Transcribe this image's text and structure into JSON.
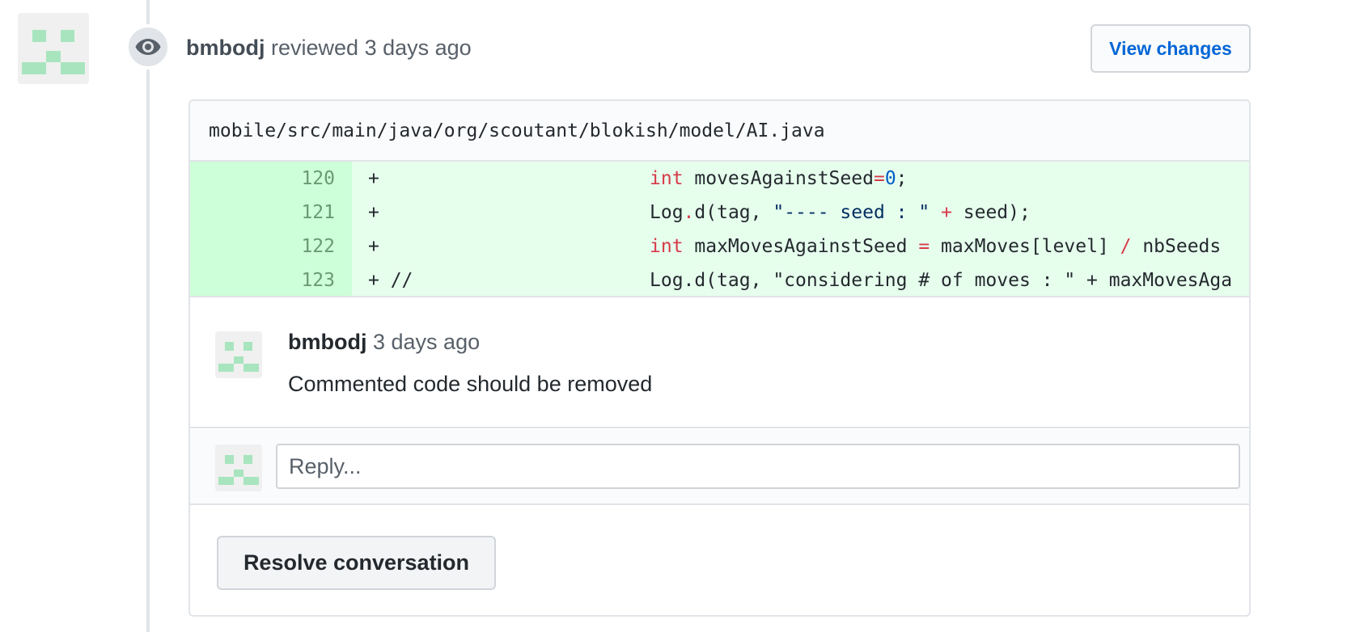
{
  "review": {
    "author": "bmbodj",
    "action": "reviewed",
    "time": "3 days ago",
    "view_changes_label": "View changes"
  },
  "file": {
    "path": "mobile/src/main/java/org/scoutant/blokish/model/AI.java"
  },
  "diff": {
    "lines": [
      {
        "number": "120",
        "prefix": "+",
        "tokens": [
          "int",
          " movesAgainstSeed",
          "=",
          "0",
          ";"
        ]
      },
      {
        "number": "121",
        "prefix": "+",
        "tokens": [
          "Log",
          ".",
          "d(tag, ",
          "\"---- seed : \"",
          " + ",
          "seed);"
        ]
      },
      {
        "number": "122",
        "prefix": "+",
        "tokens": [
          "int",
          " maxMovesAgainstSeed ",
          "=",
          " maxMoves[level] ",
          "/",
          " nbSeeds"
        ]
      },
      {
        "number": "123",
        "prefix": "+ //",
        "tokens": [
          "Log.d(tag, \"considering # of moves : \" + maxMovesAga"
        ]
      }
    ]
  },
  "comment": {
    "author": "bmbodj",
    "time": "3 days ago",
    "body": "Commented code should be removed"
  },
  "reply": {
    "placeholder": "Reply..."
  },
  "actions": {
    "resolve_label": "Resolve conversation"
  },
  "colors": {
    "identicon": "#a8e5bf",
    "addition_bg": "#e6ffed",
    "addition_gutter": "#cdffd8",
    "link": "#0366d6"
  }
}
